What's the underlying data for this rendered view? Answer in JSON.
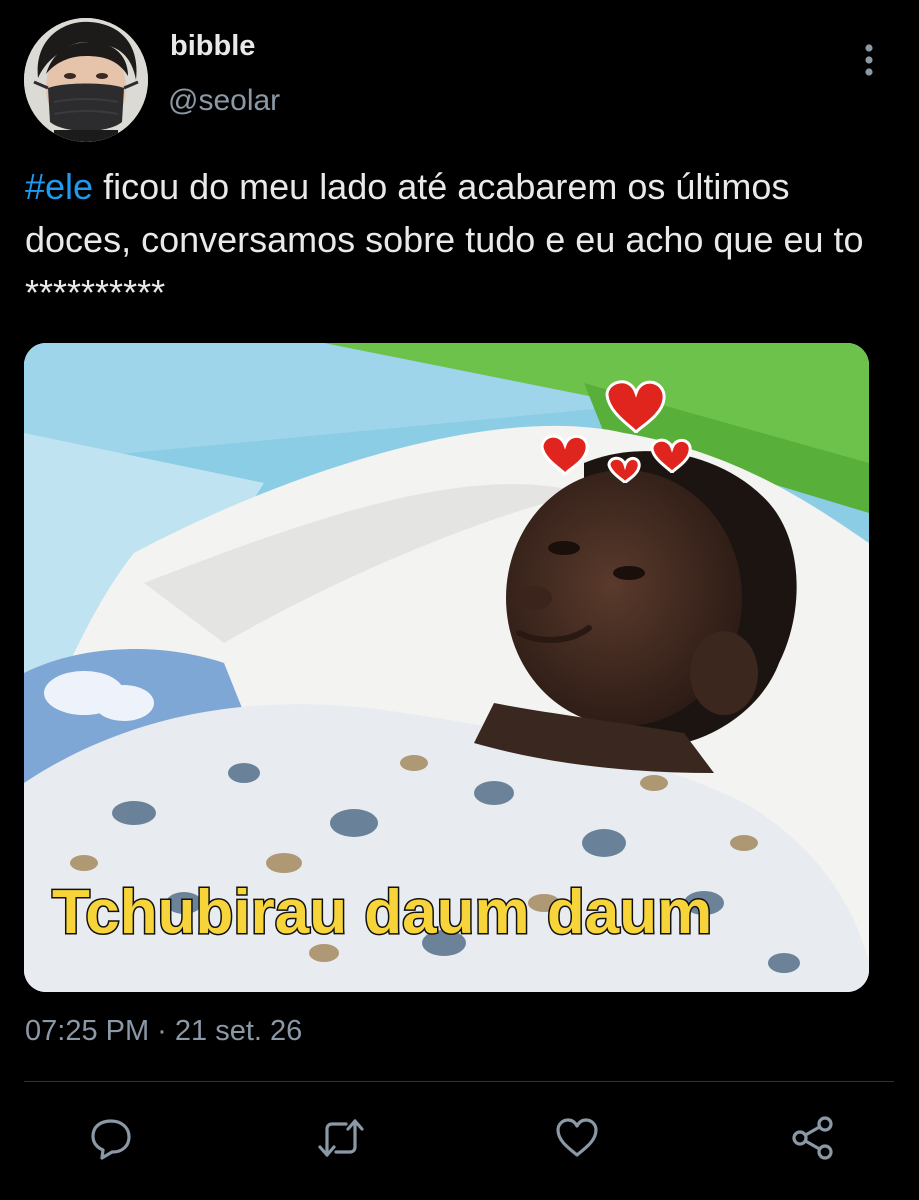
{
  "author": {
    "display_name": "bibble",
    "handle": "@seolar"
  },
  "tweet": {
    "hashtag": "#ele",
    "text": " ficou do meu lado até acabarem os últimos doces, conversamos sobre tudo e eu acho que eu to **********",
    "timestamp": "07:25 PM · 21 set. 26"
  },
  "media": {
    "caption": "Tchubirau daum daum"
  },
  "icons": {
    "more": "more-vertical-icon",
    "reply": "reply-icon",
    "retweet": "retweet-icon",
    "like": "heart-icon",
    "share": "share-icon"
  },
  "colors": {
    "background": "#000000",
    "text": "#e7e9ea",
    "secondary_text": "#8b98a5",
    "hashtag": "#1d9bf0",
    "divider": "#2f3336"
  }
}
